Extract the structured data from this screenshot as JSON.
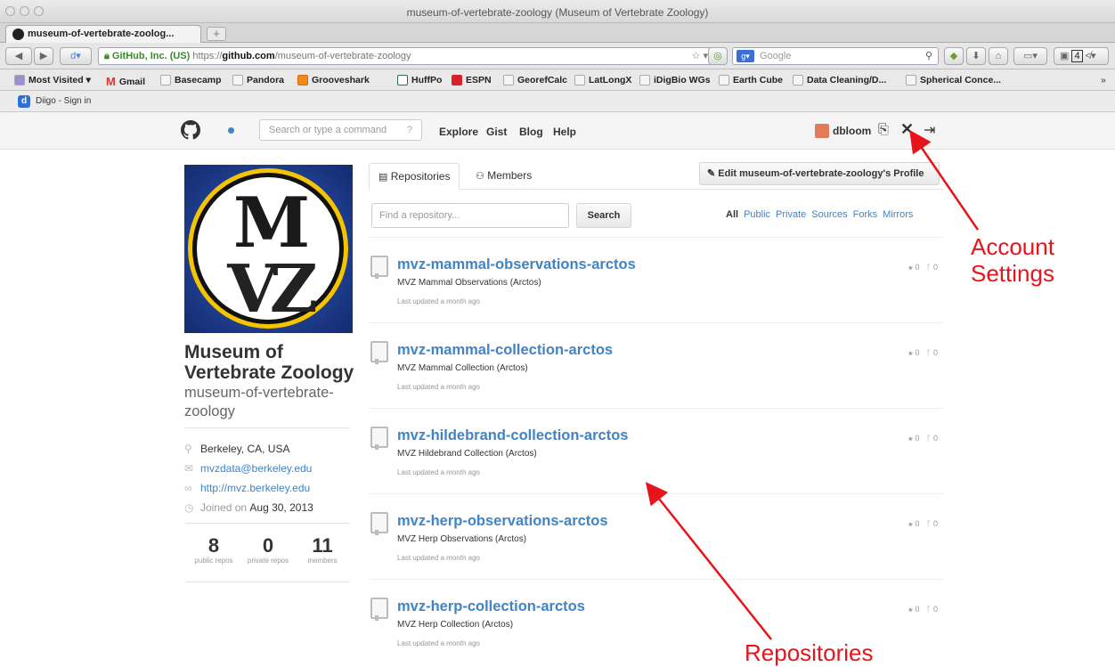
{
  "browser": {
    "window_title": "museum-of-vertebrate-zoology (Museum of Vertebrate Zoology)",
    "tab_title": "museum-of-vertebrate-zoolog...",
    "new_tab": "+",
    "identity": "GitHub, Inc. (US)",
    "url_prefix": "https://",
    "url_domain": "github.com",
    "url_path": "/museum-of-vertebrate-zoology",
    "search_engine": "Google",
    "tab_count": "4",
    "bookmarks": [
      "Most Visited ▾",
      "Gmail",
      "Basecamp",
      "Pandora",
      "Grooveshark",
      "HuffPo",
      "ESPN",
      "GeorefCalc",
      "LatLongX",
      "iDigBio WGs",
      "Earth Cube",
      "Data Cleaning/D...",
      "Spherical Conce..."
    ],
    "diigo_label": "Diigo - Sign in"
  },
  "github": {
    "search_placeholder": "Search or type a command",
    "nav": [
      "Explore",
      "Gist",
      "Blog",
      "Help"
    ],
    "username": "dbloom"
  },
  "org": {
    "name": "Museum of Vertebrate Zoology",
    "login": "museum-of-vertebrate-zoology",
    "avatar_text": "MVZ",
    "location": "Berkeley, CA, USA",
    "email": "mvzdata@berkeley.edu",
    "website": "http://mvz.berkeley.edu",
    "joined_prefix": "Joined on ",
    "joined_date": "Aug 30, 2013",
    "stats": [
      {
        "value": "8",
        "label": "public repos"
      },
      {
        "value": "0",
        "label": "private repos"
      },
      {
        "value": "11",
        "label": "members"
      }
    ]
  },
  "main": {
    "tabs": [
      "Repositories",
      "Members"
    ],
    "edit_button": "Edit museum-of-vertebrate-zoology's Profile",
    "find_placeholder": "Find a repository...",
    "search_button": "Search",
    "filters": [
      "All",
      "Public",
      "Private",
      "Sources",
      "Forks",
      "Mirrors"
    ],
    "repos": [
      {
        "name": "mvz-mammal-observations-arctos",
        "description": "MVZ Mammal Observations (Arctos)",
        "updated": "Last updated a month ago",
        "stars": "0",
        "forks": "0"
      },
      {
        "name": "mvz-mammal-collection-arctos",
        "description": "MVZ Mammal Collection (Arctos)",
        "updated": "Last updated a month ago",
        "stars": "0",
        "forks": "0"
      },
      {
        "name": "mvz-hildebrand-collection-arctos",
        "description": "MVZ Hildebrand Collection (Arctos)",
        "updated": "Last updated a month ago",
        "stars": "0",
        "forks": "0"
      },
      {
        "name": "mvz-herp-observations-arctos",
        "description": "MVZ Herp Observations (Arctos)",
        "updated": "Last updated a month ago",
        "stars": "0",
        "forks": "0"
      },
      {
        "name": "mvz-herp-collection-arctos",
        "description": "MVZ Herp Collection (Arctos)",
        "updated": "Last updated a month ago",
        "stars": "0",
        "forks": "0"
      }
    ]
  },
  "annotations": {
    "account_settings": "Account Settings",
    "repositories": "Repositories",
    "color": "#e8141b"
  }
}
